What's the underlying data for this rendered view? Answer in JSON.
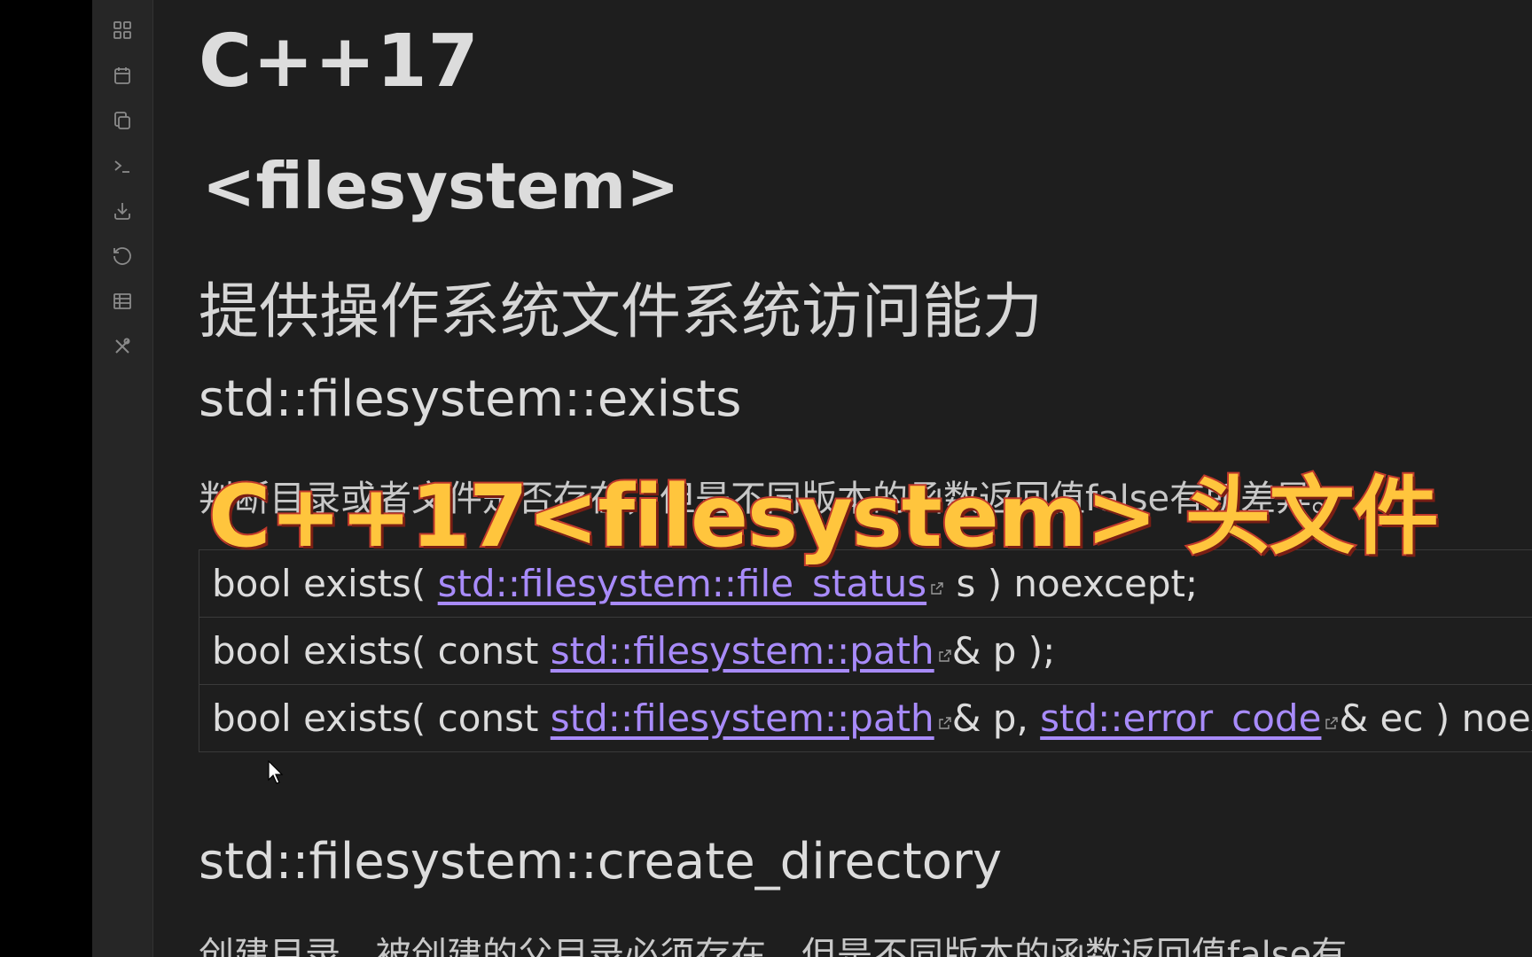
{
  "ribbon": {
    "icons": [
      "dashboard-icon",
      "calendar-icon",
      "copy-icon",
      "terminal-icon",
      "download-icon",
      "undo-icon",
      "table-icon",
      "tools-icon"
    ]
  },
  "note": {
    "h1": "C++17",
    "h2": "<filesystem>",
    "description": "提供操作系统文件系统访问能力",
    "exists": {
      "heading": "std::filesystem::exists",
      "description": "判断目录或者文件是否存在，但是不同版本的函数返回值false有所差异。",
      "signatures": [
        {
          "prefix": "bool exists( ",
          "link": "std::filesystem::file_status",
          "suffix": " s ) noexcept;"
        },
        {
          "prefix": "bool exists( const ",
          "link": "std::filesystem::path",
          "suffix": "& p );"
        },
        {
          "prefix": "bool exists( const ",
          "link": "std::filesystem::path",
          "middle": "& p, ",
          "link2": "std::error_code",
          "suffix": "& ec ) noexcept;"
        }
      ]
    },
    "create_directory": {
      "heading": "std::filesystem::create_directory",
      "description": "创建目录，被创建的父目录必须存在，但是不同版本的函数返回值false有"
    }
  },
  "overlay": {
    "title": "C++17<filesystem> 头文件"
  },
  "colors": {
    "background": "#1e1e1e",
    "link": "#a88bfa",
    "overlay_fill": "#ffc53d",
    "overlay_stroke": "#c0392b"
  }
}
